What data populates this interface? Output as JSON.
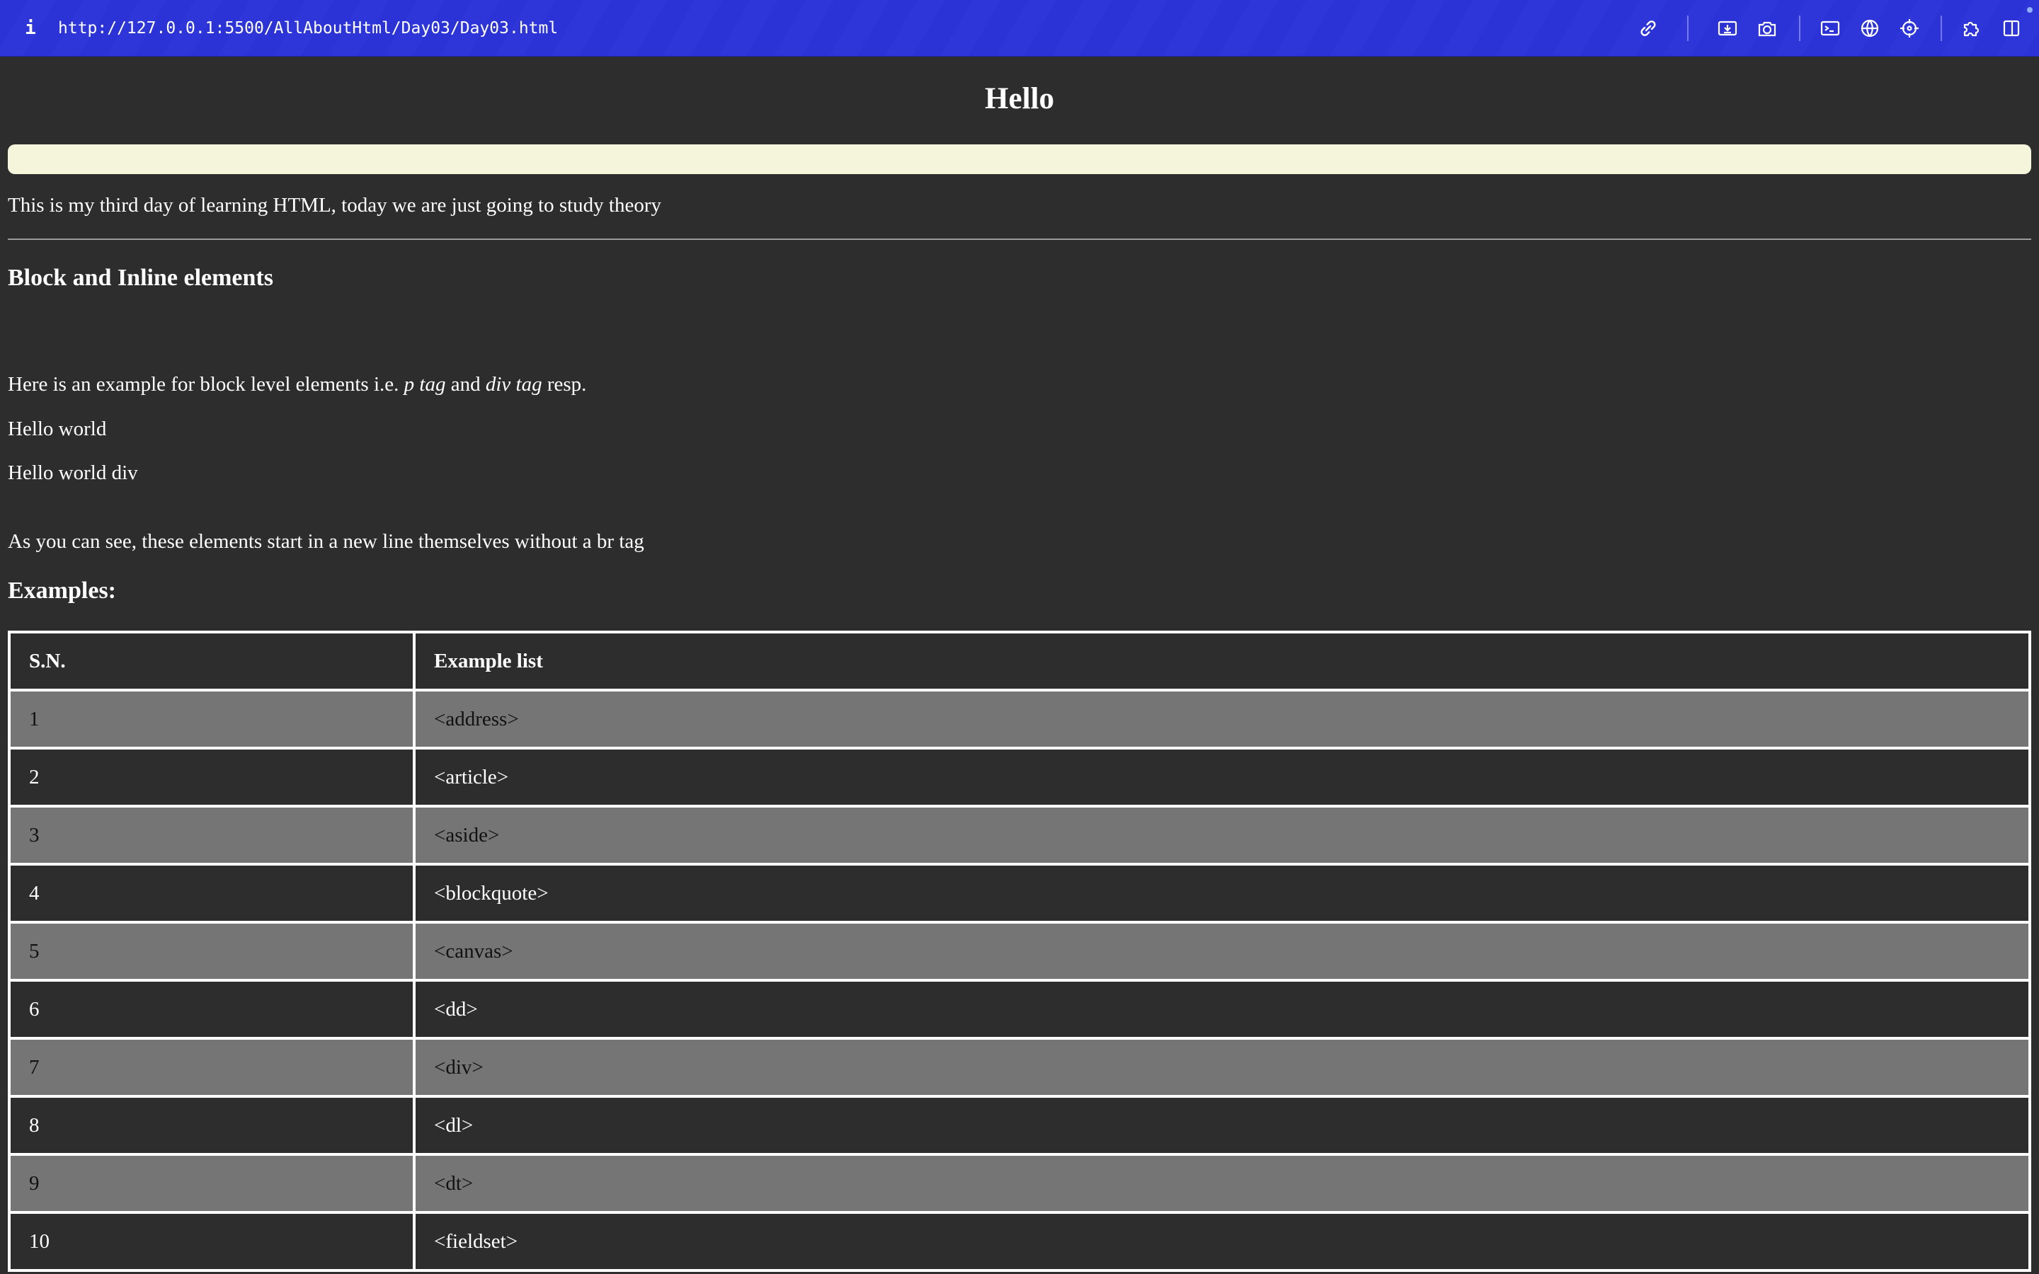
{
  "browser": {
    "url": "http://127.0.0.1:5500/AllAboutHtml/Day03/Day03.html",
    "info_label": "i",
    "toolbar_icons": [
      "link-icon",
      "download-icon",
      "camera-icon",
      "terminal-icon",
      "globe-icon",
      "crosshair-icon",
      "puzzle-icon",
      "split-view-icon"
    ]
  },
  "page": {
    "title": "Hello",
    "intro": "This is my third day of learning HTML, today we are just going to study theory",
    "section_heading": "Block and Inline elements",
    "block_intro": {
      "prefix": "Here is an example for block level elements i.e. ",
      "em1": "p tag",
      "mid": " and ",
      "em2": "div tag",
      "suffix": " resp."
    },
    "p_example": "Hello world",
    "div_example": "Hello world div",
    "note": "As you can see, these elements start in a new line themselves without a br tag",
    "examples_heading": "Examples:",
    "banner_color": "#f5f5dc"
  },
  "table": {
    "headers": [
      "S.N.",
      "Example list"
    ],
    "rows": [
      [
        "1",
        "<address>"
      ],
      [
        "2",
        "<article>"
      ],
      [
        "3",
        "<aside>"
      ],
      [
        "4",
        "<blockquote>"
      ],
      [
        "5",
        "<canvas>"
      ],
      [
        "6",
        "<dd>"
      ],
      [
        "7",
        "<div>"
      ],
      [
        "8",
        "<dl>"
      ],
      [
        "9",
        "<dt>"
      ],
      [
        "10",
        "<fieldset>"
      ]
    ]
  }
}
